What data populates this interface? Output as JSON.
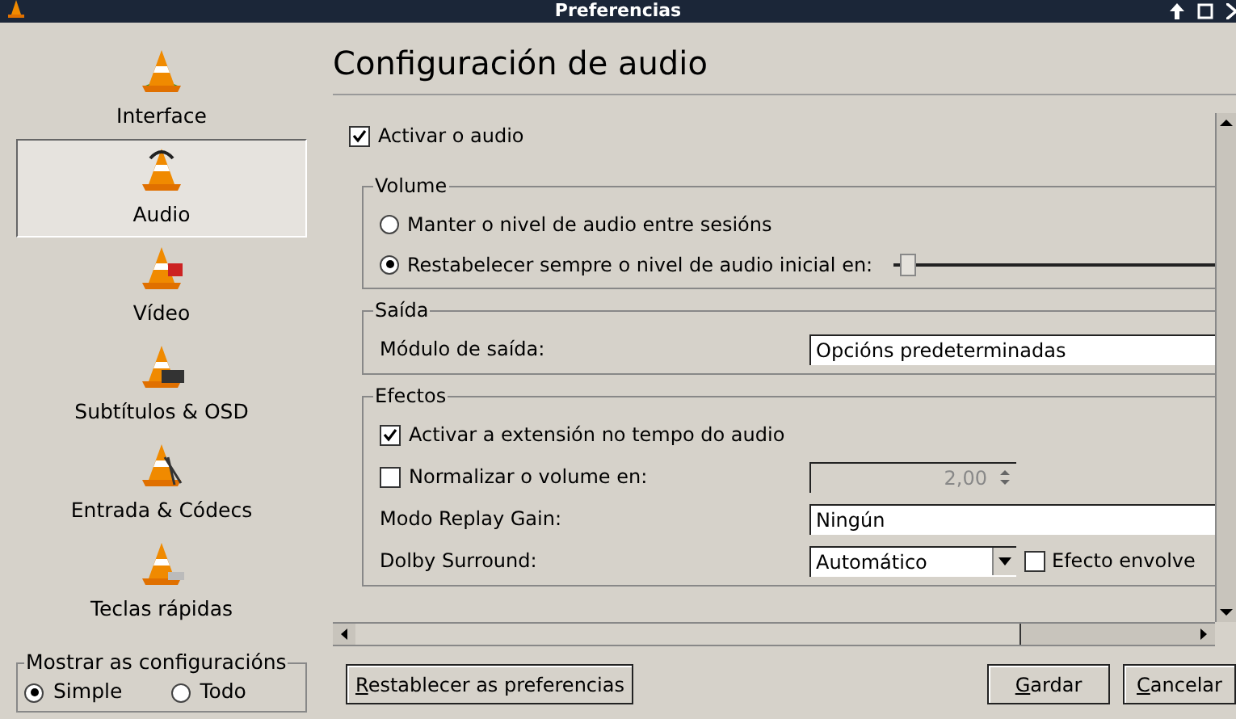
{
  "window": {
    "title": "Preferencias"
  },
  "sidebar": {
    "items": [
      {
        "label": "Interface",
        "selected": false,
        "kind": "interface"
      },
      {
        "label": "Audio",
        "selected": true,
        "kind": "audio"
      },
      {
        "label": "Vídeo",
        "selected": false,
        "kind": "video"
      },
      {
        "label": "Subtítulos & OSD",
        "selected": false,
        "kind": "subtitles"
      },
      {
        "label": "Entrada & Códecs",
        "selected": false,
        "kind": "input"
      },
      {
        "label": "Teclas rápidas",
        "selected": false,
        "kind": "hotkeys"
      }
    ],
    "show_settings": {
      "title": "Mostrar as configuracións",
      "options": [
        {
          "label": "Simple",
          "selected": true
        },
        {
          "label": "Todo",
          "selected": false
        }
      ]
    }
  },
  "panel": {
    "title": "Configuración de audio",
    "enable_audio": {
      "label": "Activar o audio",
      "checked": true
    },
    "groups": [
      {
        "title": "Volume",
        "rows": [
          {
            "kind": "radio",
            "label": "Manter o nivel de audio entre sesións",
            "selected": false
          },
          {
            "kind": "radio-slider",
            "label": "Restabelecer sempre o nivel de audio inicial en:",
            "selected": true,
            "level": 0.02
          }
        ]
      },
      {
        "title": "Saída",
        "rows": [
          {
            "kind": "text",
            "label": "Módulo de saída:",
            "value": "Opcións predeterminadas"
          }
        ]
      },
      {
        "title": "Efectos",
        "rows": [
          {
            "kind": "checkbox",
            "label": "Activar a extensión no tempo do audio",
            "checked": true
          },
          {
            "kind": "checkbox-spin",
            "label": "Normalizar o volume en:",
            "checked": false,
            "value": "2,00"
          },
          {
            "kind": "text",
            "label": "Modo Replay Gain:",
            "value": "Ningún"
          },
          {
            "kind": "select-check",
            "label": "Dolby Surround:",
            "value": "Automático",
            "check": {
              "label": "Efecto envolve",
              "checked": false
            }
          }
        ]
      }
    ]
  },
  "buttons": [
    {
      "label": "Restablecer as preferencias"
    },
    {
      "label": "Gardar"
    },
    {
      "label": "Cancelar"
    }
  ]
}
